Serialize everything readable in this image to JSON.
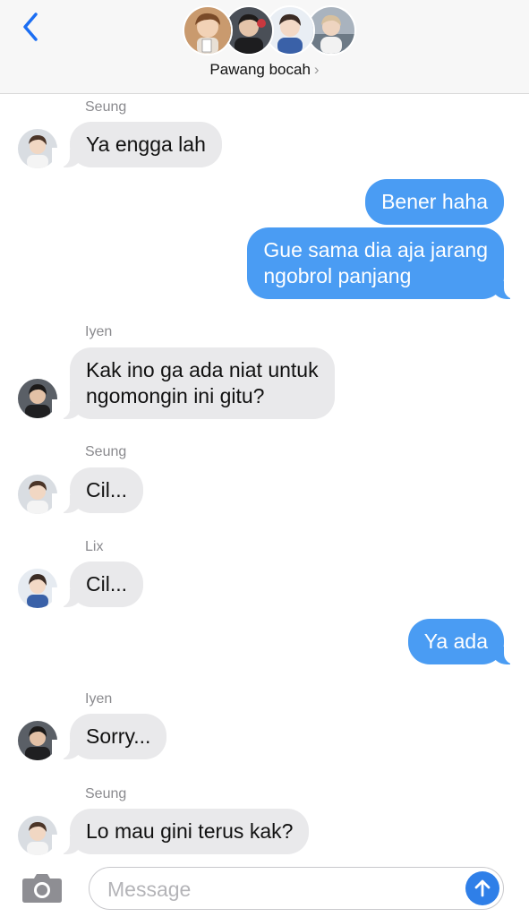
{
  "header": {
    "group_name": "Pawang bocah",
    "chevron": "›",
    "back_icon": "chevron-left-icon"
  },
  "messages": [
    {
      "sender": "Seung",
      "text": "Ya engga lah",
      "direction": "incoming"
    },
    {
      "text": "Bener haha",
      "direction": "outgoing"
    },
    {
      "text_lines": [
        "Gue sama dia aja jarang",
        "ngobrol panjang"
      ],
      "direction": "outgoing"
    },
    {
      "sender": "Iyen",
      "text_lines": [
        "Kak ino ga ada niat untuk",
        "ngomongin ini gitu?"
      ],
      "direction": "incoming"
    },
    {
      "sender": "Seung",
      "text": "Cil...",
      "direction": "incoming"
    },
    {
      "sender": "Lix",
      "text": "Cil...",
      "direction": "incoming"
    },
    {
      "text": "Ya ada",
      "direction": "outgoing"
    },
    {
      "sender": "Iyen",
      "text": "Sorry...",
      "direction": "incoming"
    },
    {
      "sender": "Seung",
      "text": "Lo mau gini terus kak?",
      "direction": "incoming"
    }
  ],
  "composer": {
    "placeholder": "Message",
    "camera_icon": "camera-icon",
    "send_icon": "arrow-up-icon"
  },
  "colors": {
    "outgoing_bubble": "#4a9cf3",
    "incoming_bubble": "#e9e9eb",
    "accent": "#2f7fe8"
  }
}
